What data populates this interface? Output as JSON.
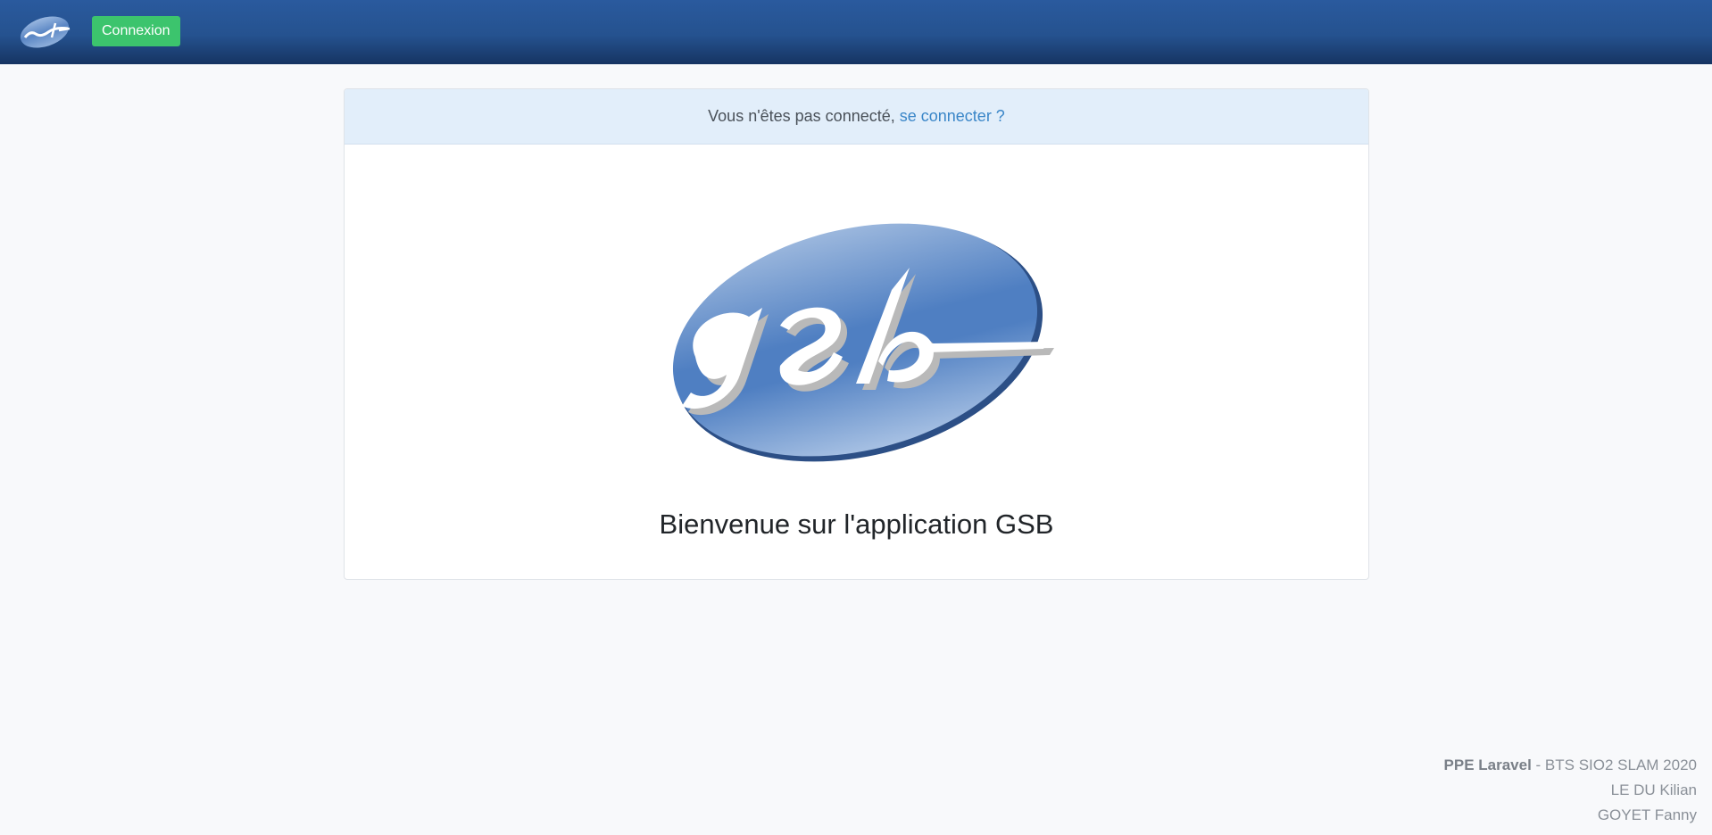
{
  "navbar": {
    "logo_text": "gsb",
    "login_button_label": "Connexion"
  },
  "card": {
    "notice_text": "Vous n'êtes pas connecté,",
    "notice_link": "se connecter ?",
    "logo_text": "gsb",
    "welcome_title": "Bienvenue sur l'application GSB"
  },
  "footer": {
    "project_name": "PPE Laravel",
    "project_suffix": " - BTS SIO2 SLAM 2020",
    "author_1": "LE DU Kilian",
    "author_2": "GOYET Fanny"
  },
  "colors": {
    "navbar": "#25528f",
    "button": "#3cc46d",
    "link": "#3a86c8",
    "notice_bg": "#e2eefa"
  }
}
